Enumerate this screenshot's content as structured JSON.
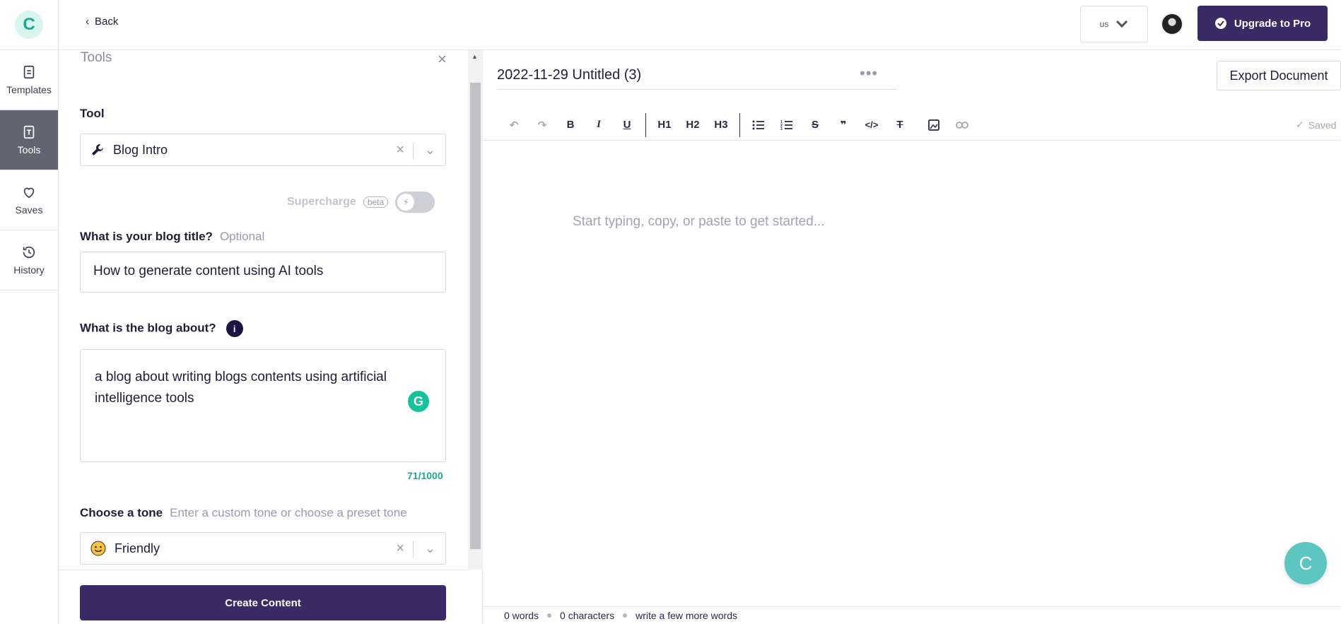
{
  "topbar": {
    "back_label": "Back",
    "country": "us",
    "upgrade_label": "Upgrade to Pro"
  },
  "rail": {
    "items": [
      {
        "label": "Templates",
        "icon": "document-icon"
      },
      {
        "label": "Tools",
        "icon": "tool-icon"
      },
      {
        "label": "Saves",
        "icon": "heart-icon"
      },
      {
        "label": "History",
        "icon": "history-icon"
      }
    ]
  },
  "panel": {
    "title": "Tools",
    "tool_label": "Tool",
    "tool_value": "Blog Intro",
    "supercharge_label": "Supercharge",
    "beta_label": "beta",
    "blog_title_label": "What is your blog title?",
    "blog_title_optional": "Optional",
    "blog_title_value": "How to generate content using AI tools",
    "about_label": "What is the blog about?",
    "about_value": "a blog about writing blogs contents using artificial intelligence tools",
    "counter": "71/1000",
    "tone_label": "Choose a tone",
    "tone_hint": "Enter a custom tone or choose a preset tone",
    "tone_value": "Friendly",
    "create_label": "Create Content"
  },
  "editor": {
    "doc_title": "2022-11-29 Untitled (3)",
    "export_label": "Export Document",
    "saved_label": "Saved",
    "placeholder": "Start typing, copy, or paste to get started...",
    "toolbar": {
      "h1": "H1",
      "h2": "H2",
      "h3": "H3",
      "bold": "B",
      "italic": "I",
      "underline": "U"
    },
    "status": {
      "words": "0 words",
      "characters": "0 characters",
      "hint": "write a few more words"
    }
  },
  "colors": {
    "primary": "#3a2a66",
    "accent": "#1aa88f",
    "fab": "#5ec6c0"
  }
}
